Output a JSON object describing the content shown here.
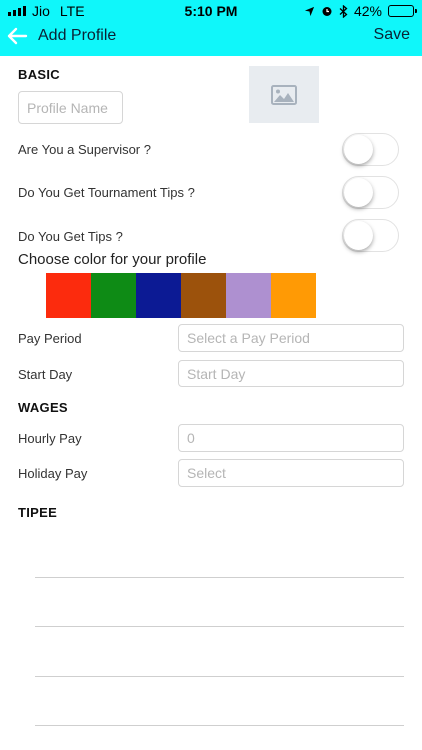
{
  "status_bar": {
    "carrier": "Jio",
    "network": "LTE",
    "time": "5:10 PM",
    "battery": "42%",
    "battery_level": 0.42,
    "icons": [
      "signal-icon",
      "location-arrow-icon",
      "alarm-icon",
      "bluetooth-icon",
      "battery-icon"
    ]
  },
  "nav": {
    "title": "Add Profile",
    "save_label": "Save",
    "back_icon": "back-arrow-icon",
    "bar_color": "#0ff7fa"
  },
  "basic": {
    "heading": "BASIC",
    "profile_name_placeholder": "Profile Name",
    "image_icon": "image-placeholder-icon"
  },
  "toggles": [
    {
      "label": "Are You a Supervisor ?",
      "on": false
    },
    {
      "label": "Do You Get Tournament Tips ?",
      "on": false
    },
    {
      "label": "Do You Get Tips ?",
      "on": false
    }
  ],
  "colors": {
    "title": "Choose color for your profile",
    "swatches": [
      "#fc2b0d",
      "#0e8b15",
      "#0c1a94",
      "#9c520c",
      "#ae90d0",
      "#ff9a05"
    ]
  },
  "pay": {
    "period_label": "Pay Period",
    "period_placeholder": "Select a Pay Period",
    "start_label": "Start Day",
    "start_placeholder": "Start Day"
  },
  "wages": {
    "heading": "WAGES",
    "hourly_label": "Hourly Pay",
    "hourly_placeholder": "0",
    "holiday_label": "Holiday Pay",
    "holiday_placeholder": "Select"
  },
  "tipee": {
    "heading": "TIPEE"
  }
}
